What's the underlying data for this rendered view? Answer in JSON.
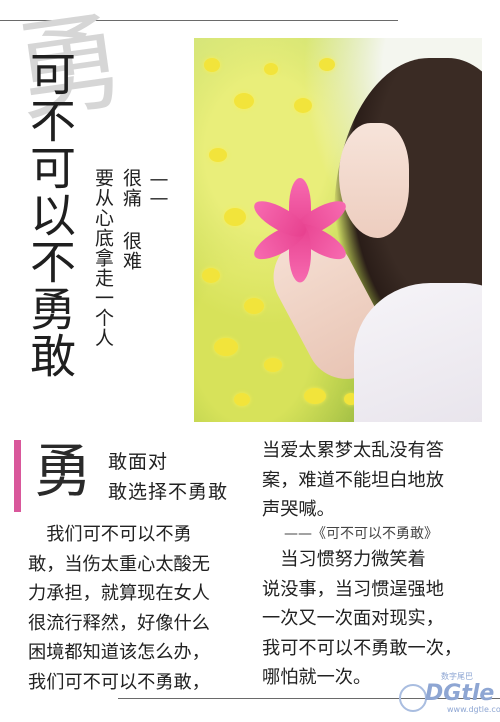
{
  "title": "可不可以不勇敢",
  "watermark_char": "勇",
  "subtitle": {
    "dash": "——",
    "line1": "很痛 很难",
    "line2": "要从心底拿走一个人"
  },
  "photo": {
    "icon": "portrait-with-lily-photo"
  },
  "section": {
    "big_char": "勇",
    "line1": "敢面对",
    "line2": "敢选择不勇敢"
  },
  "left_paragraph": [
    "　我们可不可以不勇",
    "敢，当伤太重心太酸无",
    "力承担，就算现在女人",
    "很流行释然，好像什么",
    "困境都知道该怎么办，",
    "我们可不可以不勇敢，"
  ],
  "right_paragraph_top": [
    "当爱太累梦太乱没有答",
    "案，难道不能坦白地放",
    "声哭喊。"
  ],
  "quote": "——《可不可以不勇敢》",
  "right_paragraph_bottom": [
    "　当习惯努力微笑着",
    "说没事，当习惯逞强地",
    "一次又一次面对现实，",
    "我可不可以不勇敢一次，",
    "哪怕就一次。"
  ],
  "logo": {
    "name": "DGtle",
    "tag": "数字尾巴",
    "url": "www.dgtle.com"
  },
  "colors": {
    "accent": "#d9579b",
    "logo": "#8ea6d3"
  }
}
